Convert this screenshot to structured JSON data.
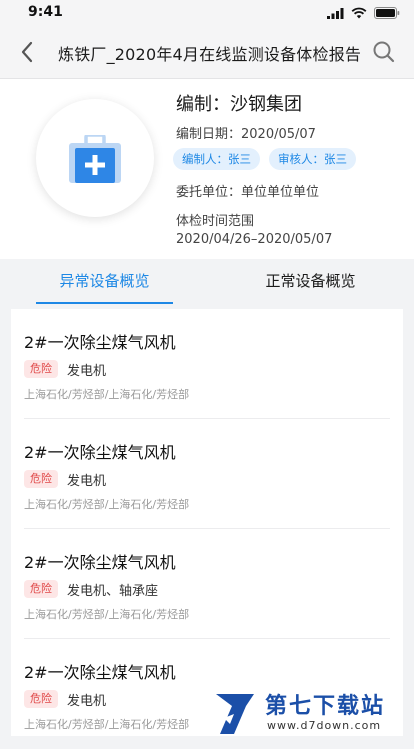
{
  "status_bar": {
    "time": "9:41"
  },
  "nav": {
    "title": "炼铁厂_2020年4月在线监测设备体检报告"
  },
  "info": {
    "title": "编制：沙钢集团",
    "compile_date": "编制日期：2020/05/07",
    "editor": "编制人：张三",
    "reviewer": "审核人：张三",
    "client": "委托单位：单位单位单位",
    "range_label": "体检时间范围",
    "range_value": "2020/04/26–2020/05/07"
  },
  "tabs": [
    {
      "label": "异常设备概览",
      "active": true
    },
    {
      "label": "正常设备概览",
      "active": false
    }
  ],
  "devices": [
    {
      "name": "2#一次除尘煤气风机",
      "level": "危险",
      "parts": "发电机",
      "path": "上海石化/芳烃部/上海石化/芳烃部"
    },
    {
      "name": "2#一次除尘煤气风机",
      "level": "危险",
      "parts": "发电机",
      "path": "上海石化/芳烃部/上海石化/芳烃部"
    },
    {
      "name": "2#一次除尘煤气风机",
      "level": "危险",
      "parts": "发电机、轴承座",
      "path": "上海石化/芳烃部/上海石化/芳烃部"
    },
    {
      "name": "2#一次除尘煤气风机",
      "level": "危险",
      "parts": "发电机",
      "path": "上海石化/芳烃部/上海石化/芳烃部"
    }
  ],
  "watermark": {
    "title": "第七下载站",
    "url": "www.d7down.com"
  },
  "colors": {
    "accent": "#1e88e5",
    "danger_text": "#e04848",
    "danger_bg": "#fde6e6"
  }
}
